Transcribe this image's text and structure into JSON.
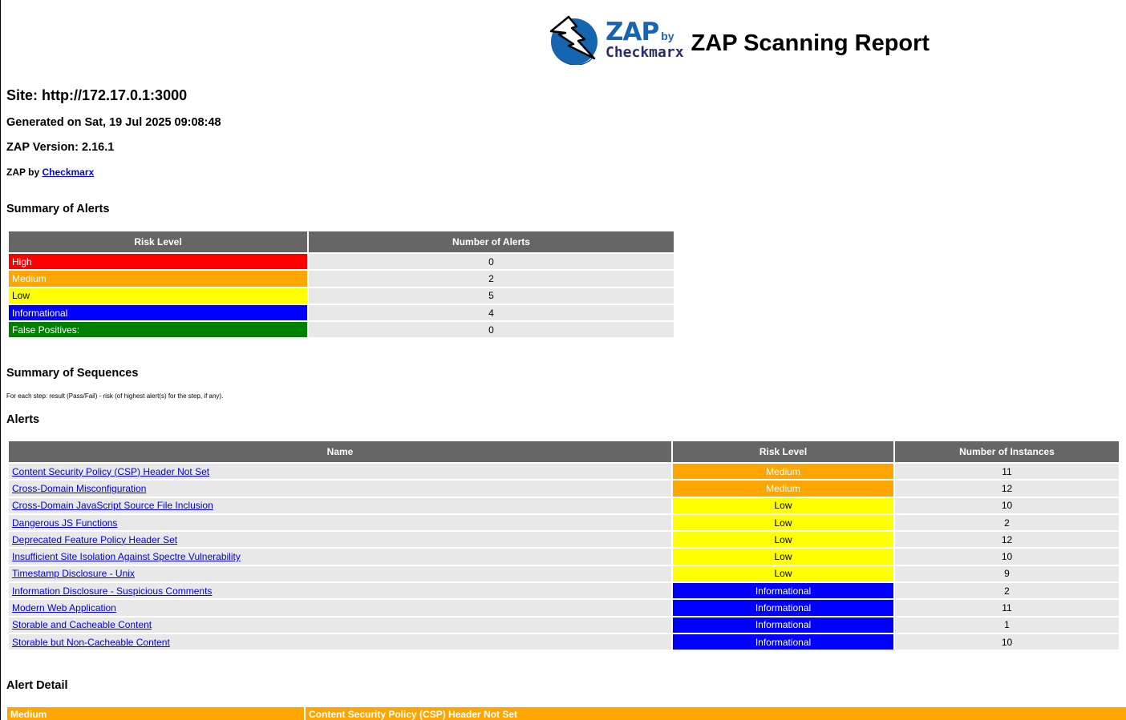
{
  "header": {
    "logo_zap": "ZAP",
    "logo_by": "by",
    "logo_checkmarx": "Checkmarx",
    "title": "ZAP Scanning Report"
  },
  "site": "Site: http://172.17.0.1:3000",
  "generated": "Generated on Sat, 19 Jul 2025 09:08:48",
  "version": "ZAP Version: 2.16.1",
  "by_prefix": "ZAP by ",
  "by_link": "Checkmarx",
  "summary_alerts": {
    "heading": "Summary of Alerts",
    "columns": [
      "Risk Level",
      "Number of Alerts"
    ],
    "rows": [
      {
        "level": "High",
        "count": "0"
      },
      {
        "level": "Medium",
        "count": "2"
      },
      {
        "level": "Low",
        "count": "5"
      },
      {
        "level": "Informational",
        "count": "4"
      },
      {
        "level": "False Positives:",
        "count": "0"
      }
    ]
  },
  "summary_sequences": {
    "heading": "Summary of Sequences",
    "note": "For each step: result (Pass/Fail) - risk (of highest alert(s) for the step, if any)."
  },
  "alerts": {
    "heading": "Alerts",
    "columns": [
      "Name",
      "Risk Level",
      "Number of Instances"
    ],
    "rows": [
      {
        "name": "Content Security Policy (CSP) Header Not Set",
        "risk": "Medium",
        "instances": "11"
      },
      {
        "name": "Cross-Domain Misconfiguration",
        "risk": "Medium",
        "instances": "12"
      },
      {
        "name": "Cross-Domain JavaScript Source File Inclusion",
        "risk": "Low",
        "instances": "10"
      },
      {
        "name": "Dangerous JS Functions",
        "risk": "Low",
        "instances": "2"
      },
      {
        "name": "Deprecated Feature Policy Header Set",
        "risk": "Low",
        "instances": "12"
      },
      {
        "name": "Insufficient Site Isolation Against Spectre Vulnerability",
        "risk": "Low",
        "instances": "10"
      },
      {
        "name": "Timestamp Disclosure - Unix",
        "risk": "Low",
        "instances": "9"
      },
      {
        "name": "Information Disclosure - Suspicious Comments",
        "risk": "Informational",
        "instances": "2"
      },
      {
        "name": "Modern Web Application",
        "risk": "Informational",
        "instances": "11"
      },
      {
        "name": "Storable and Cacheable Content",
        "risk": "Informational",
        "instances": "1"
      },
      {
        "name": "Storable but Non-Cacheable Content",
        "risk": "Informational",
        "instances": "10"
      }
    ]
  },
  "alert_detail": {
    "heading": "Alert Detail",
    "first_risk": "Medium",
    "first_name": "Content Security Policy (CSP) Header Not Set"
  },
  "colors": {
    "High": "#ff0000",
    "Medium": "#ffa500",
    "Low": "#ffff00",
    "Informational": "#0000ff",
    "False Positives:": "#008000",
    "header_bg": "#666666",
    "row_bg": "#e8e8e8",
    "logo_blue": "#1565b0"
  }
}
